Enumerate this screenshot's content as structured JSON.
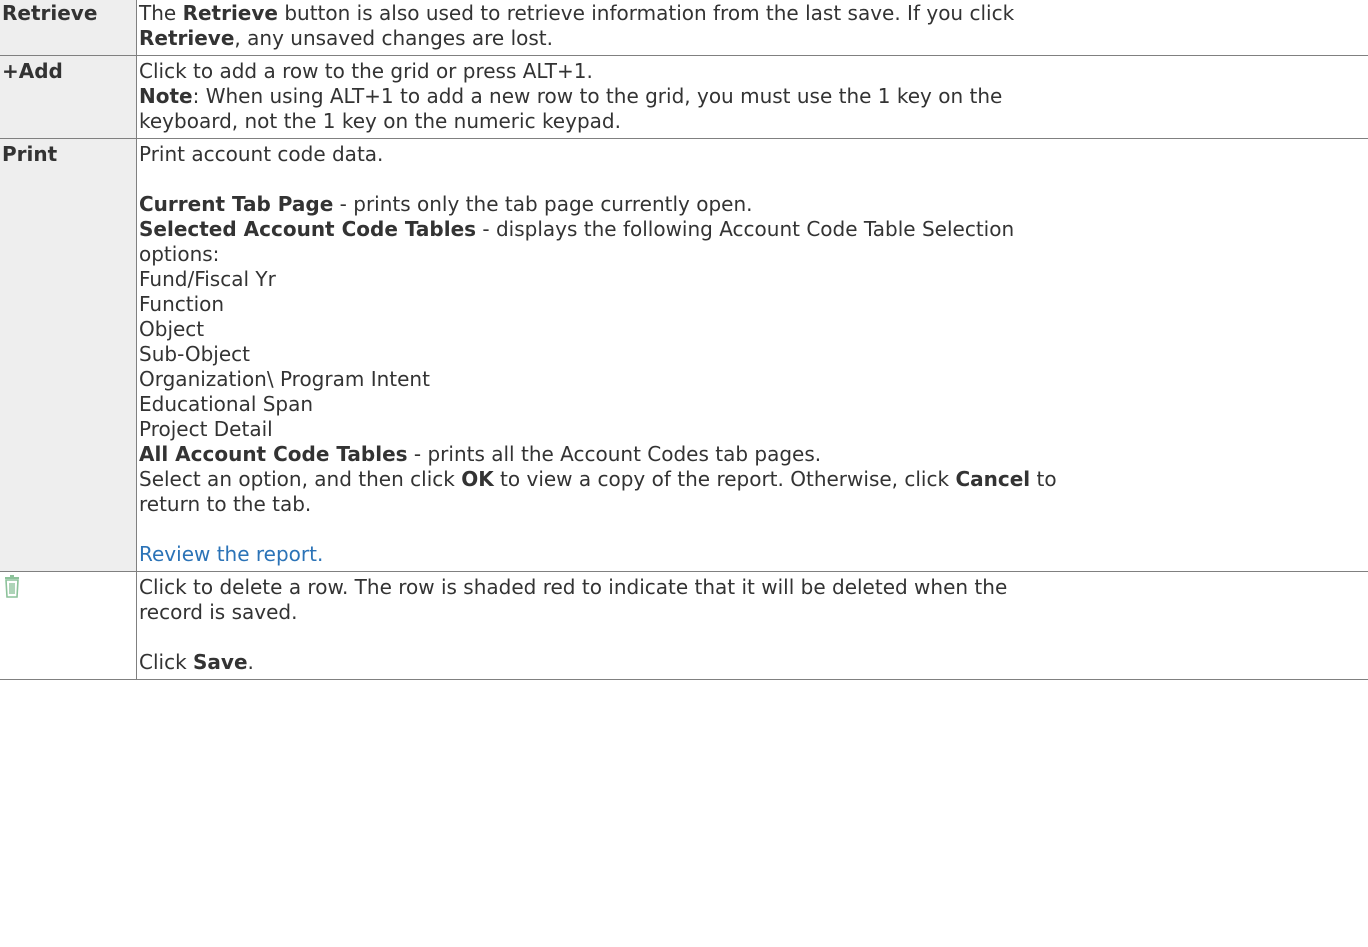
{
  "rows": {
    "retrieve": {
      "label": "Retrieve",
      "text1": "The ",
      "bold1": "Retrieve",
      "text2": " button is also used to retrieve information from the last save. If you click",
      "bold2": "Retrieve",
      "text3": ", any unsaved changes are lost."
    },
    "add": {
      "label": "+Add",
      "line1": "Click to add a row to the grid or press ALT+1.",
      "note_label": "Note",
      "note_text1": ": When using ALT+1 to add a new row to the grid, you must use the 1 key on the",
      "note_text2": "keyboard, not the 1 key on the numeric keypad."
    },
    "print": {
      "label": "Print",
      "intro": "Print account code data.",
      "current_tab_label": "Current Tab Page",
      "current_tab_text": " - prints only the tab page currently open.",
      "selected_label": "Selected Account Code Tables",
      "selected_text1": " - displays the following Account Code Table Selection",
      "selected_text2": "options:",
      "options": [
        "Fund/Fiscal Yr",
        "Function",
        "Object",
        "Sub-Object",
        "Organization\\ Program Intent",
        "Educational Span",
        "Project Detail"
      ],
      "all_label": "All Account Code Tables",
      "all_text": " - prints all the Account Codes tab pages.",
      "select_text1": "Select an option, and then click ",
      "ok_label": "OK",
      "select_text2": " to view a copy of the report. Otherwise, click ",
      "cancel_label": "Cancel",
      "select_text3": " to",
      "select_text4": "return to the tab.",
      "review_link": "Review the report."
    },
    "delete": {
      "icon": "trash-icon",
      "line1": "Click to delete a row. The row is shaded red to indicate that it will be deleted when the",
      "line2": "record is saved.",
      "save_text1": "Click ",
      "save_label": "Save",
      "save_text2": "."
    }
  },
  "colors": {
    "link": "#2b73b7",
    "label_bg": "#eeeeee",
    "icon_green": "#8cc29a"
  }
}
